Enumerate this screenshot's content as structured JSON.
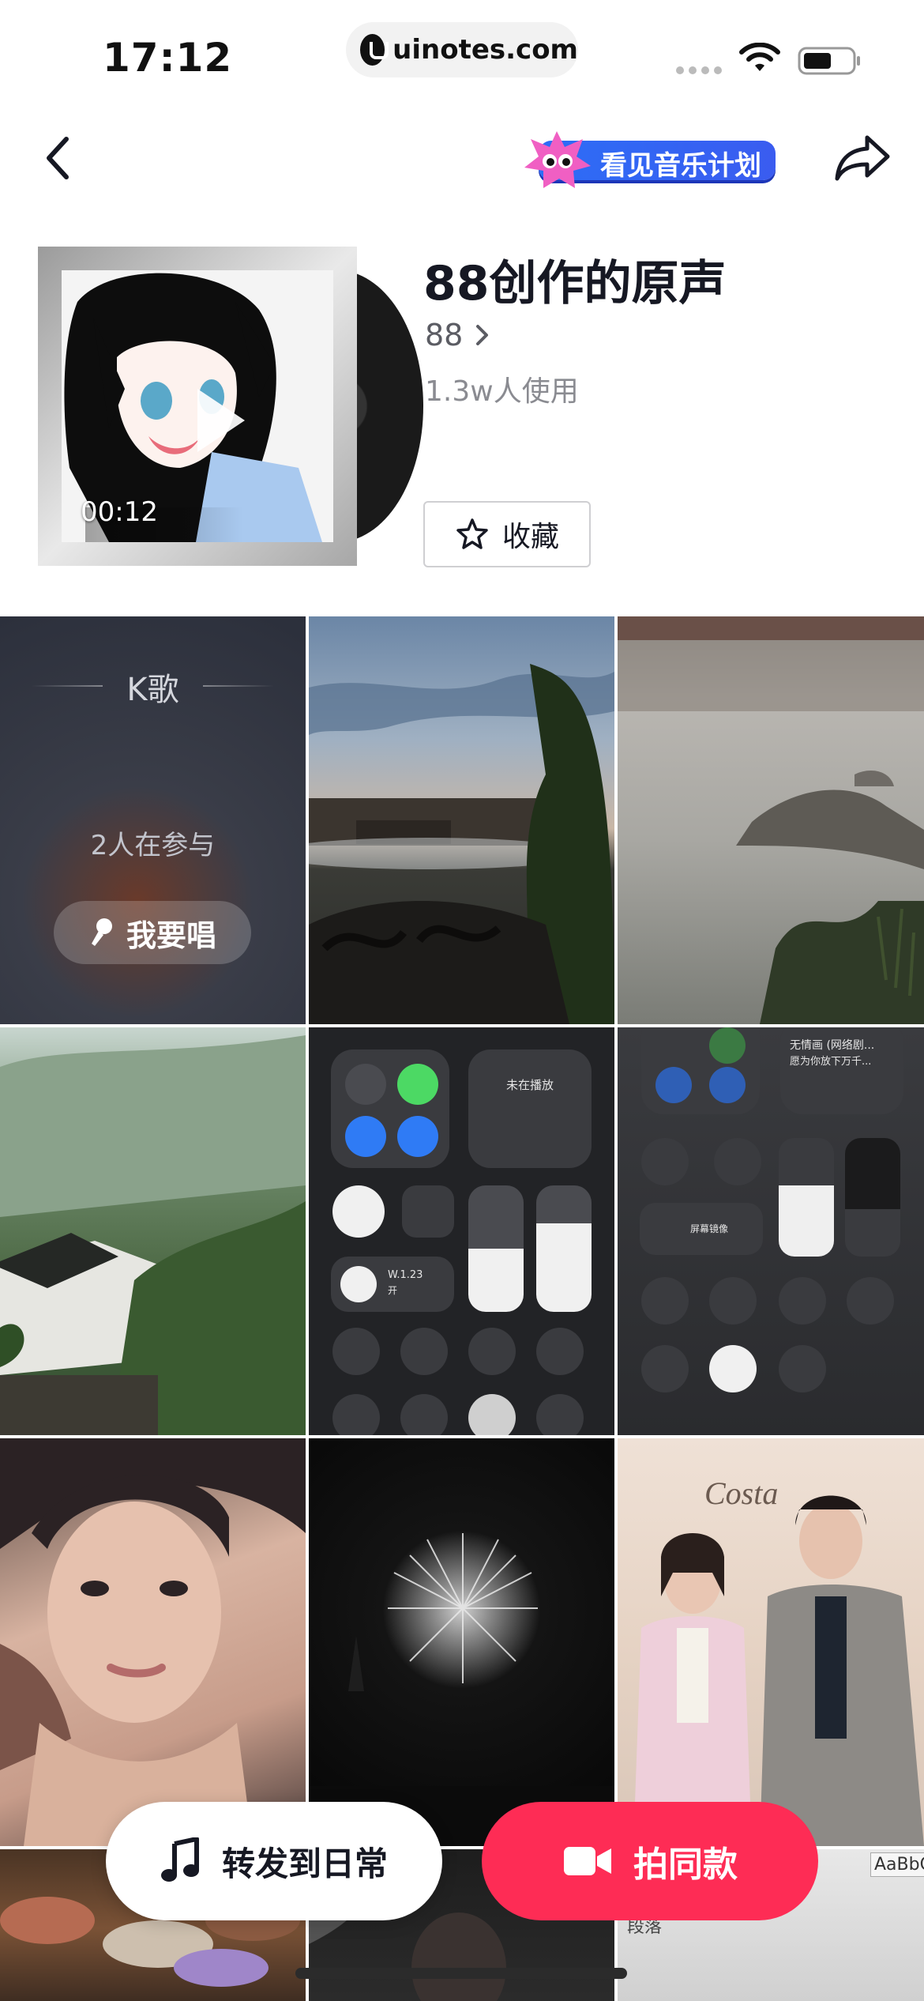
{
  "status_bar": {
    "time": "17:12",
    "url": "uinotes.com"
  },
  "nav": {
    "banner_text": "看见音乐计划"
  },
  "song": {
    "title": "88创作的原声",
    "artist": "88",
    "usage": "1.3w人使用",
    "duration": "00:12",
    "favorite_label": "收藏"
  },
  "ktv": {
    "title": "K歌",
    "participants": "2人在参与",
    "sing_label": "我要唱"
  },
  "control_center": {
    "tile1_now_playing": "未在播放",
    "tile1_focus_name": "W.1.23",
    "tile1_focus_sub": "开",
    "tile2_song": "无情画 (网络剧...",
    "tile2_song_sub": "愿为你放下万千...",
    "tile2_mirror": "屏幕镜像"
  },
  "tiles_text": {
    "couple_logo": "Costa",
    "doc_text": "AaBbC",
    "doc_label": "段落"
  },
  "actions": {
    "share_label": "转发到日常",
    "shoot_label": "拍同款"
  },
  "colors": {
    "accent": "#fe2c55",
    "banner_blue": "#2d6df6"
  }
}
